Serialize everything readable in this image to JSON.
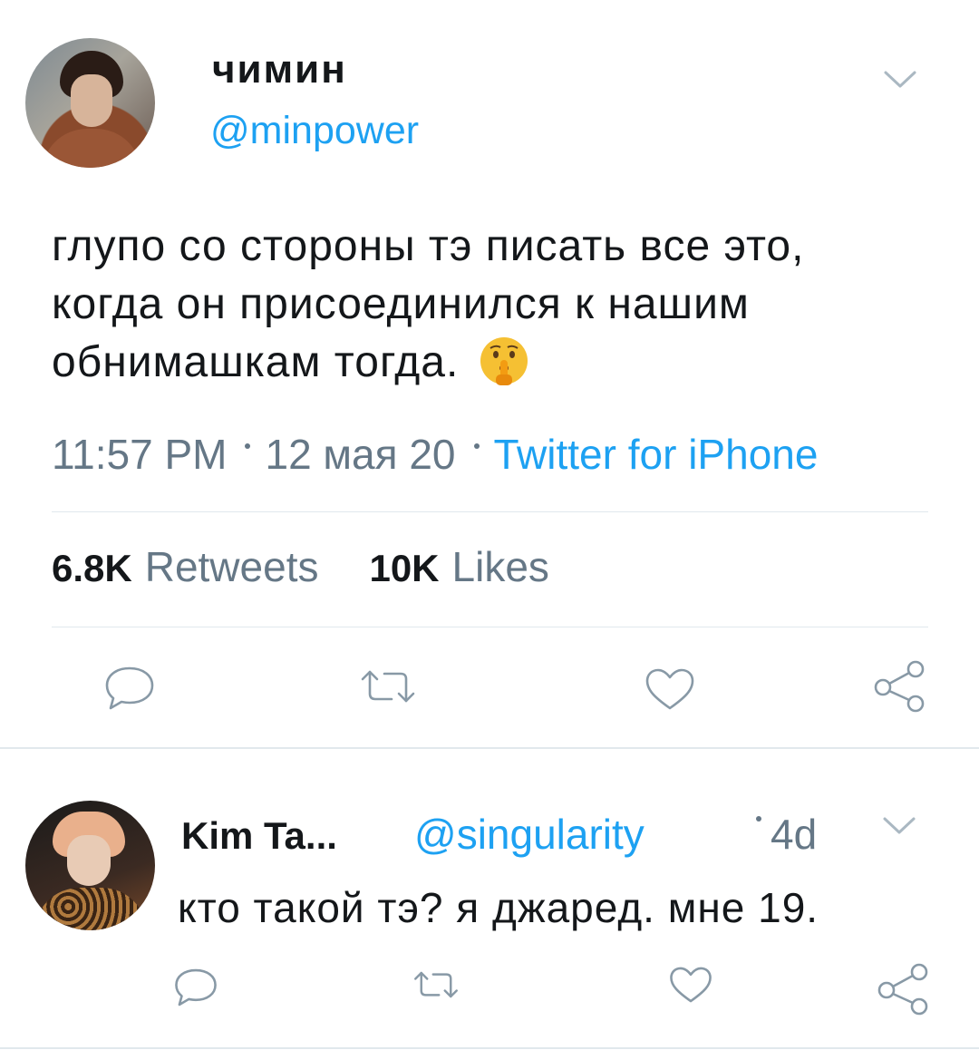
{
  "tweet": {
    "display_name": "чимин",
    "handle": "@minpower",
    "text": "глупо со стороны тэ писать все это, когда он присоединился к нашим обнимашкам тогда.",
    "emoji": "shushing-face",
    "time": "11:57 PM",
    "date": "12 мая 20",
    "source": "Twitter for iPhone",
    "retweets_count": "6.8K",
    "retweets_label": "Retweets",
    "likes_count": "10K",
    "likes_label": "Likes"
  },
  "reply": {
    "display_name": "Kim Ta...",
    "handle": "@singularity",
    "time": "4d",
    "text": "кто такой тэ? я джаред. мне 19."
  },
  "colors": {
    "accent": "#1da1f2",
    "secondary_text": "#657786",
    "primary_text": "#14171a",
    "divider": "#e1e8ed"
  },
  "icons": {
    "reply": "reply-icon",
    "retweet": "retweet-icon",
    "like": "heart-icon",
    "share": "share-icon",
    "menu": "chevron-down-icon"
  }
}
